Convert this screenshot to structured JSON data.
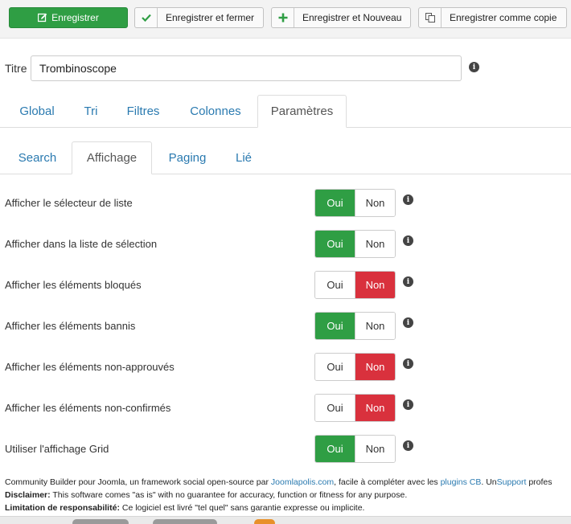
{
  "toolbar": {
    "save": "Enregistrer",
    "save_close": "Enregistrer et fermer",
    "save_new": "Enregistrer et Nouveau",
    "save_copy": "Enregistrer comme copie"
  },
  "form": {
    "title_label": "Titre",
    "title_value": "Trombinoscope"
  },
  "main_tabs": [
    "Global",
    "Tri",
    "Filtres",
    "Colonnes",
    "Paramètres"
  ],
  "main_tab_active": "Paramètres",
  "sub_tabs": [
    "Search",
    "Affichage",
    "Paging",
    "Lié"
  ],
  "sub_tab_active": "Affichage",
  "toggle_labels": {
    "yes": "Oui",
    "no": "Non"
  },
  "settings": [
    {
      "label": "Afficher le sélecteur de liste",
      "value": "Oui"
    },
    {
      "label": "Afficher dans la liste de sélection",
      "value": "Oui"
    },
    {
      "label": "Afficher les éléments bloqués",
      "value": "Non"
    },
    {
      "label": "Afficher les éléments bannis",
      "value": "Oui"
    },
    {
      "label": "Afficher les éléments non-approuvés",
      "value": "Non"
    },
    {
      "label": "Afficher les éléments non-confirmés",
      "value": "Non"
    },
    {
      "label": "Utiliser l'affichage Grid",
      "value": "Oui"
    }
  ],
  "footer": {
    "line1_a": "Community Builder pour Joomla, un framework social open-source par ",
    "line1_link1": "Joomlapolis.com",
    "line1_b": ", facile à compléter avec les ",
    "line1_link2": "plugins CB",
    "line1_c": ". Un",
    "line1_link3": "Support",
    "line1_d": " profes",
    "line2_bold": "Disclaimer:",
    "line2_text": " This software comes \"as is\" with no guarantee for accuracy, function or fitness for any purpose.",
    "line3_bold": "Limitation de responsabilité:",
    "line3_text": " Ce logiciel est livré \"tel quel\" sans garantie expresse ou implicite."
  },
  "colors": {
    "success": "#2f9e44",
    "danger": "#d9313d",
    "link": "#2a7ab0"
  }
}
